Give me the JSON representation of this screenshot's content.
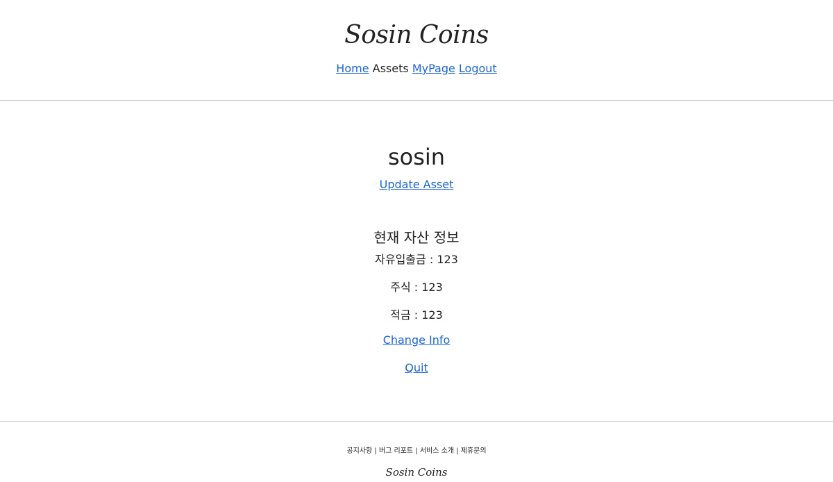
{
  "header": {
    "brand": "Sosin Coins",
    "nav": {
      "home": "Home",
      "assets": "Assets",
      "mypage": "MyPage",
      "logout": "Logout"
    }
  },
  "main": {
    "username": "sosin",
    "update_asset": "Update Asset",
    "section_title": "현재 자산 정보",
    "assets": [
      {
        "label": "자유입출금",
        "sep": " : ",
        "value": "123"
      },
      {
        "label": "주식",
        "sep": " : ",
        "value": "123"
      },
      {
        "label": "적금",
        "sep": " : ",
        "value": "123"
      }
    ],
    "change_info": "Change Info",
    "quit": "Quit"
  },
  "footer": {
    "links_text": "공지사항 | 버그 리포트 | 서비스 소개 | 제휴문의",
    "brand": "Sosin Coins"
  },
  "colors": {
    "link": "#1a64d6",
    "text": "#222222",
    "divider": "#c8c8c8",
    "background": "#ffffff"
  }
}
